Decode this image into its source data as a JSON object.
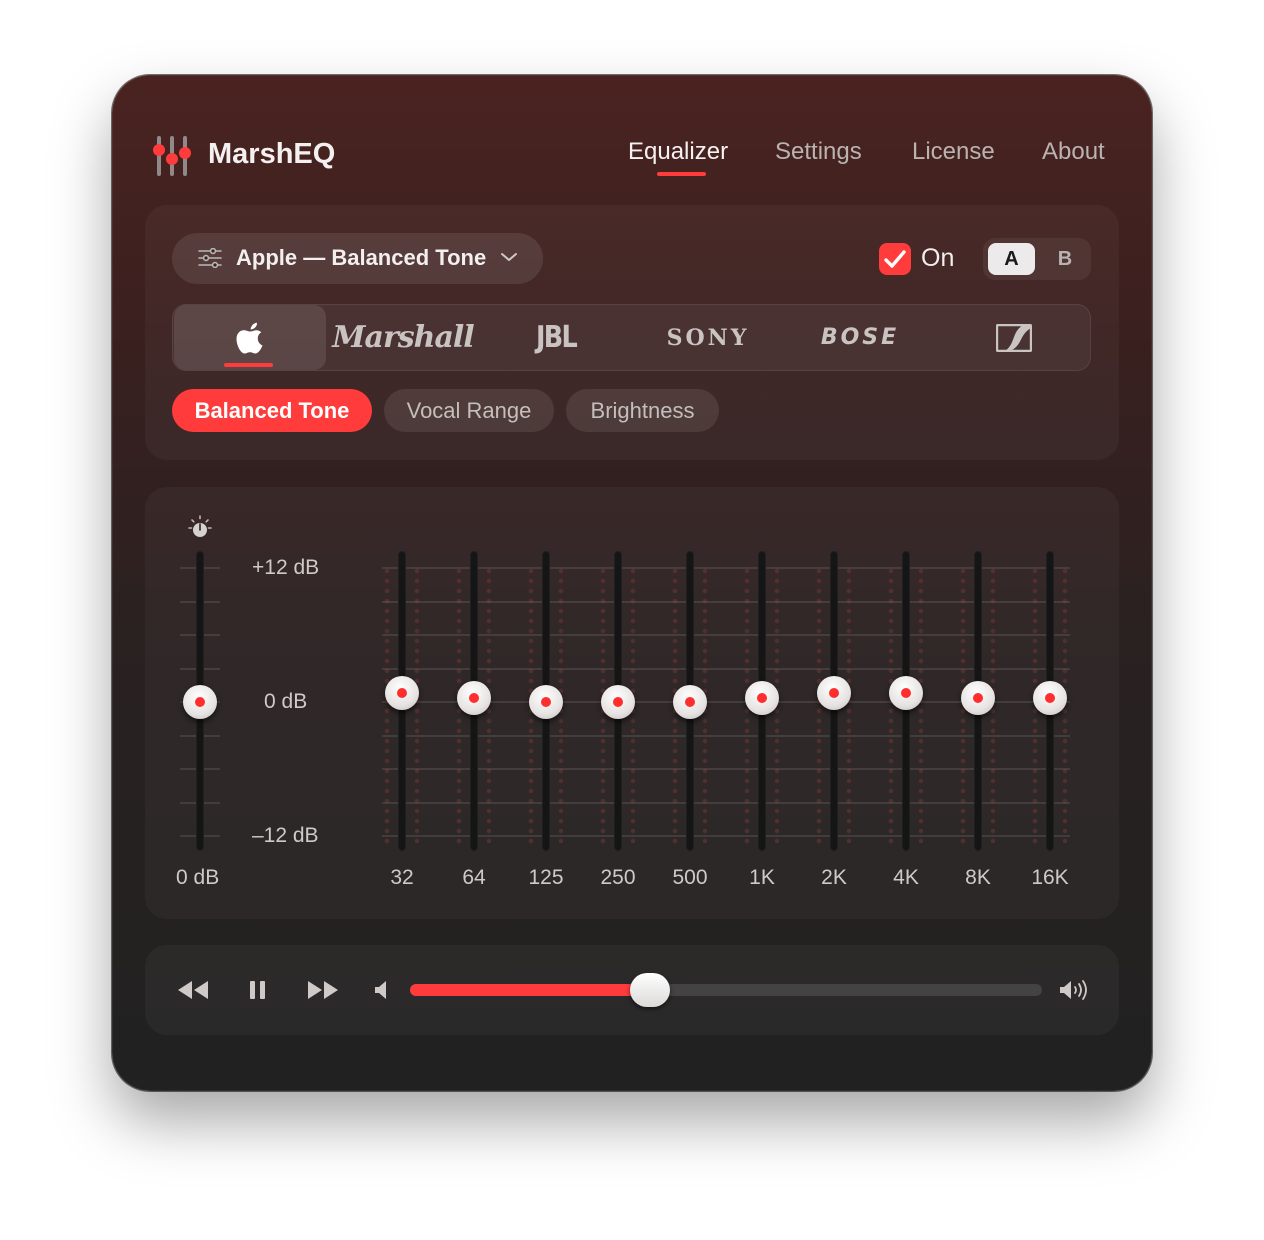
{
  "app": {
    "title": "MarshEQ"
  },
  "nav": {
    "items": [
      {
        "label": "Equalizer",
        "active": true
      },
      {
        "label": "Settings",
        "active": false
      },
      {
        "label": "License",
        "active": false
      },
      {
        "label": "About",
        "active": false
      }
    ]
  },
  "preset": {
    "current": "Apple — Balanced Tone"
  },
  "power": {
    "label": "On",
    "checked": true
  },
  "ab": {
    "a": "A",
    "b": "B",
    "selected": "A"
  },
  "brands": {
    "selected": "apple",
    "items": [
      {
        "id": "apple",
        "text": ""
      },
      {
        "id": "marshall",
        "text": "Marshall"
      },
      {
        "id": "jbl",
        "text": "JBL"
      },
      {
        "id": "sony",
        "text": "SONY"
      },
      {
        "id": "bose",
        "text": "BOSE"
      },
      {
        "id": "sennheiser",
        "text": ""
      }
    ]
  },
  "tone_chips": [
    {
      "label": "Balanced Tone",
      "selected": true
    },
    {
      "label": "Vocal Range",
      "selected": false
    },
    {
      "label": "Brightness",
      "selected": false
    }
  ],
  "eq": {
    "scale": {
      "max_label": "+12 dB",
      "mid_label": "0 dB",
      "min_label": "–12 dB",
      "range_db": [
        -12,
        12
      ]
    },
    "preamp": {
      "label": "0 dB",
      "value_db": 0
    },
    "bands": [
      {
        "freq": "32",
        "gain_db": 0.8
      },
      {
        "freq": "64",
        "gain_db": 0.4
      },
      {
        "freq": "125",
        "gain_db": 0
      },
      {
        "freq": "250",
        "gain_db": 0
      },
      {
        "freq": "500",
        "gain_db": 0
      },
      {
        "freq": "1K",
        "gain_db": 0.4
      },
      {
        "freq": "2K",
        "gain_db": 0.8
      },
      {
        "freq": "4K",
        "gain_db": 0.8
      },
      {
        "freq": "8K",
        "gain_db": 0.4
      },
      {
        "freq": "16K",
        "gain_db": 0.4
      }
    ]
  },
  "player": {
    "volume": 0.38
  },
  "colors": {
    "accent": "#ff3b3b",
    "window_top": "#4a2320",
    "window_bottom": "#212121"
  },
  "icons": [
    "mixer-logo-icon",
    "sliders-icon",
    "chevron-down-icon",
    "checkmark-icon",
    "apple-logo-icon",
    "sennheiser-logo-icon",
    "gain-knob-icon",
    "rewind-icon",
    "pause-icon",
    "fast-forward-icon",
    "speaker-low-icon",
    "speaker-high-icon"
  ]
}
